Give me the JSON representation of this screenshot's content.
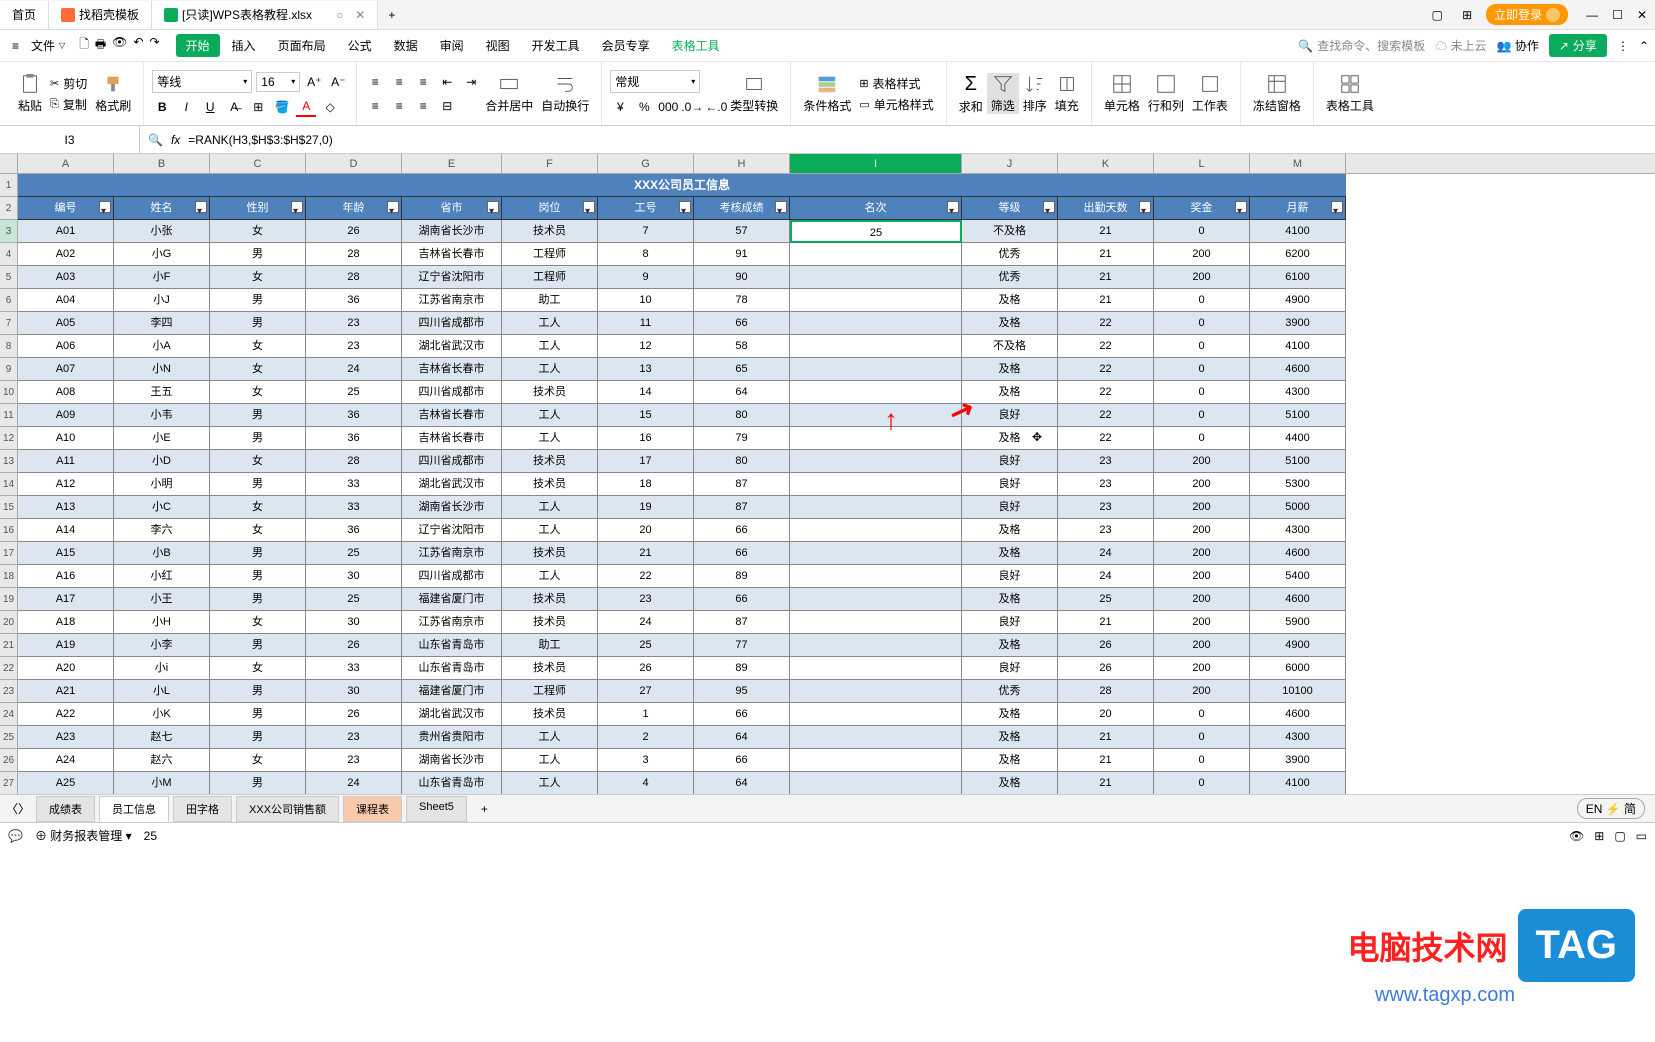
{
  "app": {
    "home_tab": "首页",
    "template_tab": "找稻壳模板",
    "file_tab": "[只读]WPS表格教程.xlsx",
    "login": "立即登录"
  },
  "menu": {
    "file": "文件",
    "items": [
      "开始",
      "插入",
      "页面布局",
      "公式",
      "数据",
      "审阅",
      "视图",
      "开发工具",
      "会员专享",
      "表格工具"
    ],
    "search_placeholder": "查找命令、搜索模板",
    "cloud": "未上云",
    "coop": "协作",
    "share": "分享"
  },
  "ribbon": {
    "paste": "粘贴",
    "cut": "剪切",
    "copy": "复制",
    "format_painter": "格式刷",
    "font_name": "等线",
    "font_size": "16",
    "merge": "合并居中",
    "wrap": "自动换行",
    "num_format": "常规",
    "type_convert": "类型转换",
    "cond_format": "条件格式",
    "table_style": "表格样式",
    "cell_style": "单元格样式",
    "sum": "求和",
    "filter": "筛选",
    "sort": "排序",
    "fill": "填充",
    "cell": "单元格",
    "rowcol": "行和列",
    "sheet": "工作表",
    "freeze": "冻结窗格",
    "tools": "表格工具"
  },
  "cell_ref": "I3",
  "formula": "=RANK(H3,$H$3:$H$27,0)",
  "columns": [
    "A",
    "B",
    "C",
    "D",
    "E",
    "F",
    "G",
    "H",
    "I",
    "J",
    "K",
    "L",
    "M"
  ],
  "table_title": "XXX公司员工信息",
  "headers": [
    "编号",
    "姓名",
    "性别",
    "年龄",
    "省市",
    "岗位",
    "工号",
    "考核成绩",
    "名次",
    "等级",
    "出勤天数",
    "奖金",
    "月薪"
  ],
  "chart_data": {
    "type": "table",
    "rows": [
      [
        "A01",
        "小张",
        "女",
        "26",
        "湖南省长沙市",
        "技术员",
        "7",
        "57",
        "25",
        "不及格",
        "21",
        "0",
        "4100"
      ],
      [
        "A02",
        "小G",
        "男",
        "28",
        "吉林省长春市",
        "工程师",
        "8",
        "91",
        "",
        "优秀",
        "21",
        "200",
        "6200"
      ],
      [
        "A03",
        "小F",
        "女",
        "28",
        "辽宁省沈阳市",
        "工程师",
        "9",
        "90",
        "",
        "优秀",
        "21",
        "200",
        "6100"
      ],
      [
        "A04",
        "小J",
        "男",
        "36",
        "江苏省南京市",
        "助工",
        "10",
        "78",
        "",
        "及格",
        "21",
        "0",
        "4900"
      ],
      [
        "A05",
        "李四",
        "男",
        "23",
        "四川省成都市",
        "工人",
        "11",
        "66",
        "",
        "及格",
        "22",
        "0",
        "3900"
      ],
      [
        "A06",
        "小A",
        "女",
        "23",
        "湖北省武汉市",
        "工人",
        "12",
        "58",
        "",
        "不及格",
        "22",
        "0",
        "4100"
      ],
      [
        "A07",
        "小N",
        "女",
        "24",
        "吉林省长春市",
        "工人",
        "13",
        "65",
        "",
        "及格",
        "22",
        "0",
        "4600"
      ],
      [
        "A08",
        "王五",
        "女",
        "25",
        "四川省成都市",
        "技术员",
        "14",
        "64",
        "",
        "及格",
        "22",
        "0",
        "4300"
      ],
      [
        "A09",
        "小韦",
        "男",
        "36",
        "吉林省长春市",
        "工人",
        "15",
        "80",
        "",
        "良好",
        "22",
        "0",
        "5100"
      ],
      [
        "A10",
        "小E",
        "男",
        "36",
        "吉林省长春市",
        "工人",
        "16",
        "79",
        "",
        "及格",
        "22",
        "0",
        "4400"
      ],
      [
        "A11",
        "小D",
        "女",
        "28",
        "四川省成都市",
        "技术员",
        "17",
        "80",
        "",
        "良好",
        "23",
        "200",
        "5100"
      ],
      [
        "A12",
        "小明",
        "男",
        "33",
        "湖北省武汉市",
        "技术员",
        "18",
        "87",
        "",
        "良好",
        "23",
        "200",
        "5300"
      ],
      [
        "A13",
        "小C",
        "女",
        "33",
        "湖南省长沙市",
        "工人",
        "19",
        "87",
        "",
        "良好",
        "23",
        "200",
        "5000"
      ],
      [
        "A14",
        "李六",
        "女",
        "36",
        "辽宁省沈阳市",
        "工人",
        "20",
        "66",
        "",
        "及格",
        "23",
        "200",
        "4300"
      ],
      [
        "A15",
        "小B",
        "男",
        "25",
        "江苏省南京市",
        "技术员",
        "21",
        "66",
        "",
        "及格",
        "24",
        "200",
        "4600"
      ],
      [
        "A16",
        "小红",
        "男",
        "30",
        "四川省成都市",
        "工人",
        "22",
        "89",
        "",
        "良好",
        "24",
        "200",
        "5400"
      ],
      [
        "A17",
        "小王",
        "男",
        "25",
        "福建省厦门市",
        "技术员",
        "23",
        "66",
        "",
        "及格",
        "25",
        "200",
        "4600"
      ],
      [
        "A18",
        "小H",
        "女",
        "30",
        "江苏省南京市",
        "技术员",
        "24",
        "87",
        "",
        "良好",
        "21",
        "200",
        "5900"
      ],
      [
        "A19",
        "小李",
        "男",
        "26",
        "山东省青岛市",
        "助工",
        "25",
        "77",
        "",
        "及格",
        "26",
        "200",
        "4900"
      ],
      [
        "A20",
        "小i",
        "女",
        "33",
        "山东省青岛市",
        "技术员",
        "26",
        "89",
        "",
        "良好",
        "26",
        "200",
        "6000"
      ],
      [
        "A21",
        "小L",
        "男",
        "30",
        "福建省厦门市",
        "工程师",
        "27",
        "95",
        "",
        "优秀",
        "28",
        "200",
        "10100"
      ],
      [
        "A22",
        "小K",
        "男",
        "26",
        "湖北省武汉市",
        "技术员",
        "1",
        "66",
        "",
        "及格",
        "20",
        "0",
        "4600"
      ],
      [
        "A23",
        "赵七",
        "男",
        "23",
        "贵州省贵阳市",
        "工人",
        "2",
        "64",
        "",
        "及格",
        "21",
        "0",
        "4300"
      ],
      [
        "A24",
        "赵六",
        "女",
        "23",
        "湖南省长沙市",
        "工人",
        "3",
        "66",
        "",
        "及格",
        "21",
        "0",
        "3900"
      ],
      [
        "A25",
        "小M",
        "男",
        "24",
        "山东省青岛市",
        "工人",
        "4",
        "64",
        "",
        "及格",
        "21",
        "0",
        "4100"
      ]
    ]
  },
  "sheets": {
    "list": [
      "成绩表",
      "员工信息",
      "田字格",
      "XXX公司销售额",
      "课程表",
      "Sheet5"
    ],
    "active": 1,
    "highlighted": 4
  },
  "status": {
    "mgmt": "财务报表管理",
    "value": "25",
    "ime": "EN",
    "ime2": "简"
  },
  "watermark": {
    "text": "电脑技术网",
    "url": "www.tagxp.com",
    "tag": "TAG"
  }
}
